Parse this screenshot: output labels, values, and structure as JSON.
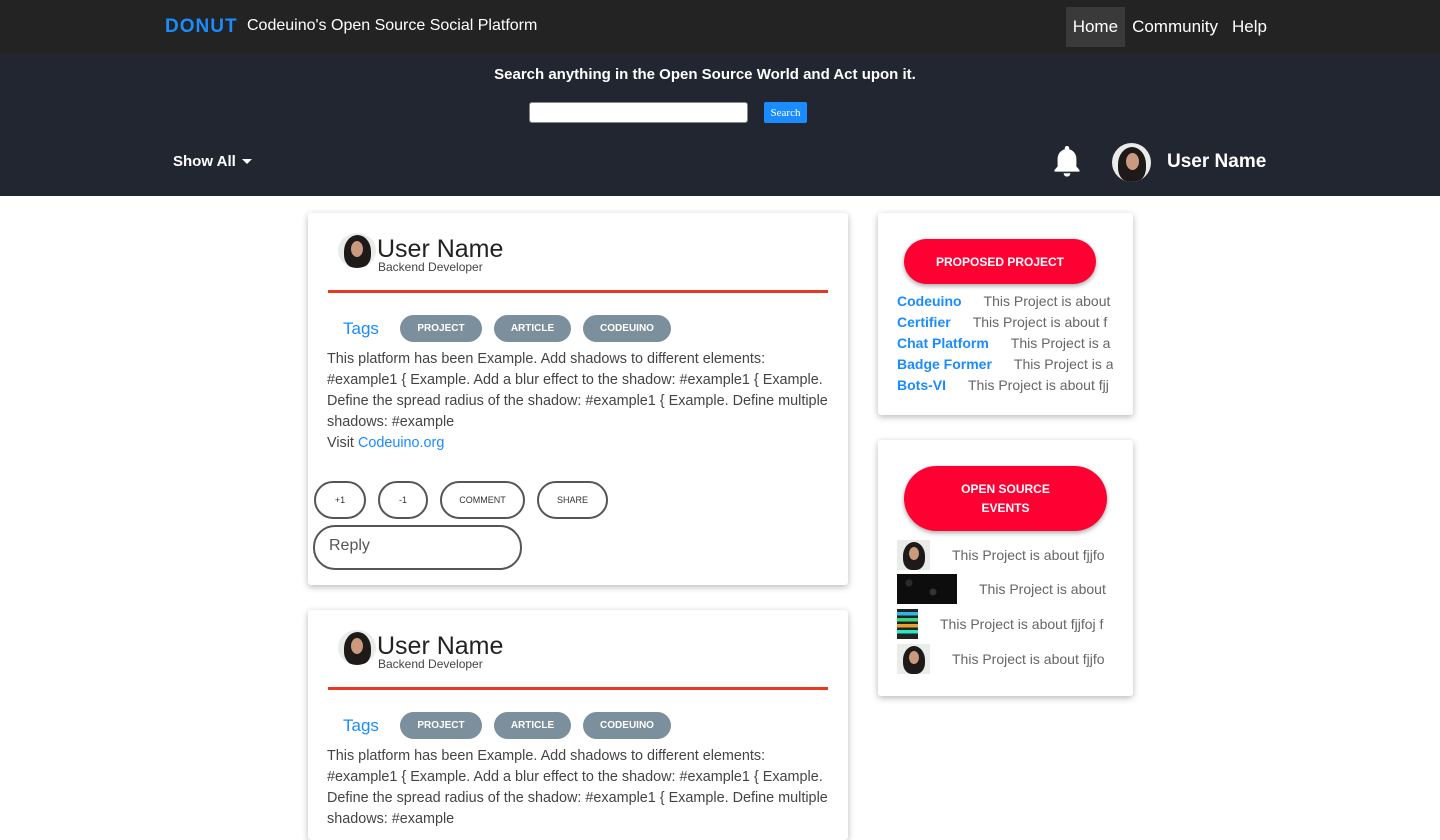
{
  "topnav": {
    "brand": "DONUT",
    "tagline": "Codeuino's Open Source Social Platform",
    "links": [
      "Home",
      "Community",
      "Help"
    ]
  },
  "search": {
    "heading": "Search anything in the Open Source World and Act upon it.",
    "value": "",
    "button": "Search"
  },
  "filter": {
    "label": "Show All"
  },
  "user": {
    "name": "User Name"
  },
  "posts": [
    {
      "user": "User Name",
      "role": "Backend Developer",
      "tags_label": "Tags",
      "tags": [
        "PROJECT",
        "ARTICLE",
        "CODEUINO"
      ],
      "body": "This platform has been Example. Add shadows to different elements: #example1 { Example. Add a blur effect to the shadow: #example1 { Example. Define the spread radius of the shadow: #example1 { Example. Define multiple shadows: #example",
      "visit_label": "Visit",
      "visit_link": "Codeuino.org",
      "actions": [
        "+1",
        "-1",
        "COMMENT",
        "SHARE"
      ],
      "reply_placeholder": "Reply"
    },
    {
      "user": "User Name",
      "role": "Backend Developer",
      "tags_label": "Tags",
      "tags": [
        "PROJECT",
        "ARTICLE",
        "CODEUINO"
      ],
      "body": "This platform has been Example. Add shadows to different elements: #example1 { Example. Add a blur effect to the shadow: #example1 { Example. Define the spread radius of the shadow: #example1 { Example. Define multiple shadows: #example"
    }
  ],
  "proposed": {
    "button": "PROPOSED PROJECT",
    "items": [
      {
        "name": "Codeuino",
        "desc": "This Project is about"
      },
      {
        "name": "Certifier",
        "desc": "This Project is about f"
      },
      {
        "name": "Chat Platform",
        "desc": "This Project is a"
      },
      {
        "name": "Badge Former",
        "desc": "This Project is a"
      },
      {
        "name": "Bots-VI",
        "desc": "This Project is about fjj"
      }
    ]
  },
  "events": {
    "button": "OPEN SOURCE EVENTS",
    "items": [
      {
        "desc": "This Project is about fjjfo"
      },
      {
        "desc": "This Project is about"
      },
      {
        "desc": "This Project is about fjjfoj f"
      },
      {
        "desc": "This Project is about fjjfo"
      }
    ]
  },
  "colors": {
    "accent": "#1a8cff",
    "nav_bg": "#232323",
    "band_bg": "#212631",
    "pill_red": "#ff0032",
    "rule_red": "#e8391e",
    "tag_grey": "#7b8f9c"
  },
  "icons": [
    "bell-icon",
    "chevron-down-icon",
    "avatar"
  ]
}
